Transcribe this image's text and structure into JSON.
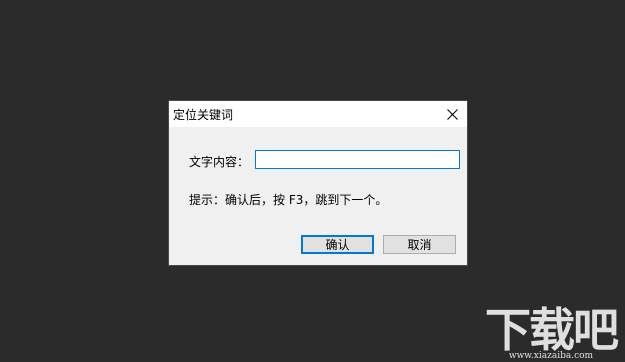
{
  "dialog": {
    "title": "定位关键词",
    "close_icon": "close-icon",
    "label": "文字内容：",
    "input_value": "",
    "hint": "提示：确认后，按 F3，跳到下一个。",
    "ok_label": "确认",
    "cancel_label": "取消"
  },
  "watermark": {
    "main": "下载吧",
    "sub": "www.xiazaiba.com"
  },
  "colors": {
    "backdrop": "#2b2b2b",
    "dialog_bg": "#f0f0f0",
    "accent": "#0078d7"
  }
}
